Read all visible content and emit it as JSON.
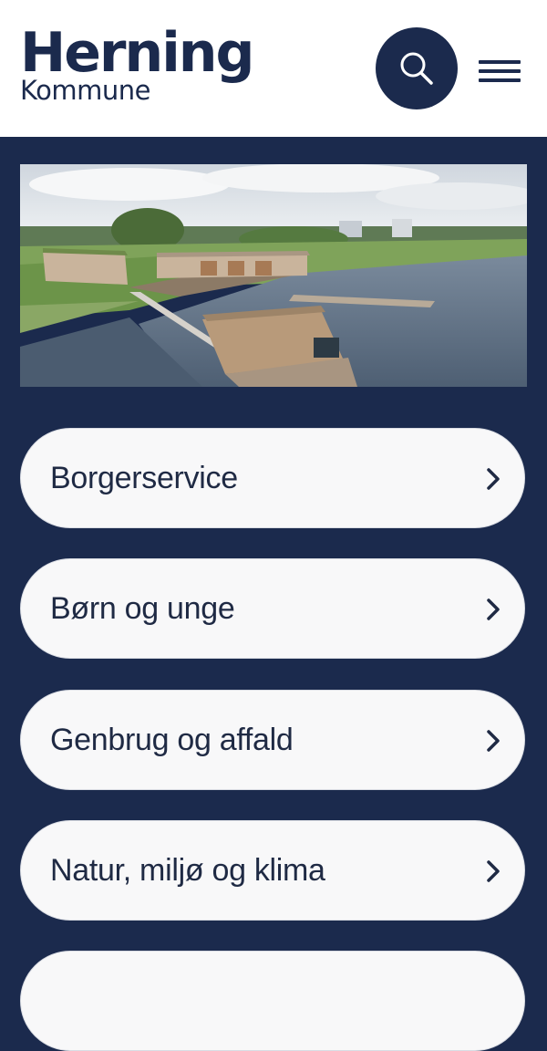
{
  "header": {
    "logo_main": "Herning",
    "logo_sub": "Kommune",
    "search_icon": "search-icon",
    "menu_icon": "hamburger-menu-icon"
  },
  "hero": {
    "image": "aerial photo of wooden buildings by a lake"
  },
  "nav": {
    "items": [
      {
        "label": "Borgerservice",
        "icon": "chevron-right-icon"
      },
      {
        "label": "Børn og unge",
        "icon": "chevron-right-icon"
      },
      {
        "label": "Genbrug og affald",
        "icon": "chevron-right-icon"
      },
      {
        "label": "Natur, miljø og klima",
        "icon": "chevron-right-icon"
      },
      {
        "label": "",
        "icon": "chevron-right-icon"
      }
    ]
  },
  "colors": {
    "brand": "#1b2a4d",
    "card": "#f8f8f9",
    "text": "#1f2a44"
  }
}
